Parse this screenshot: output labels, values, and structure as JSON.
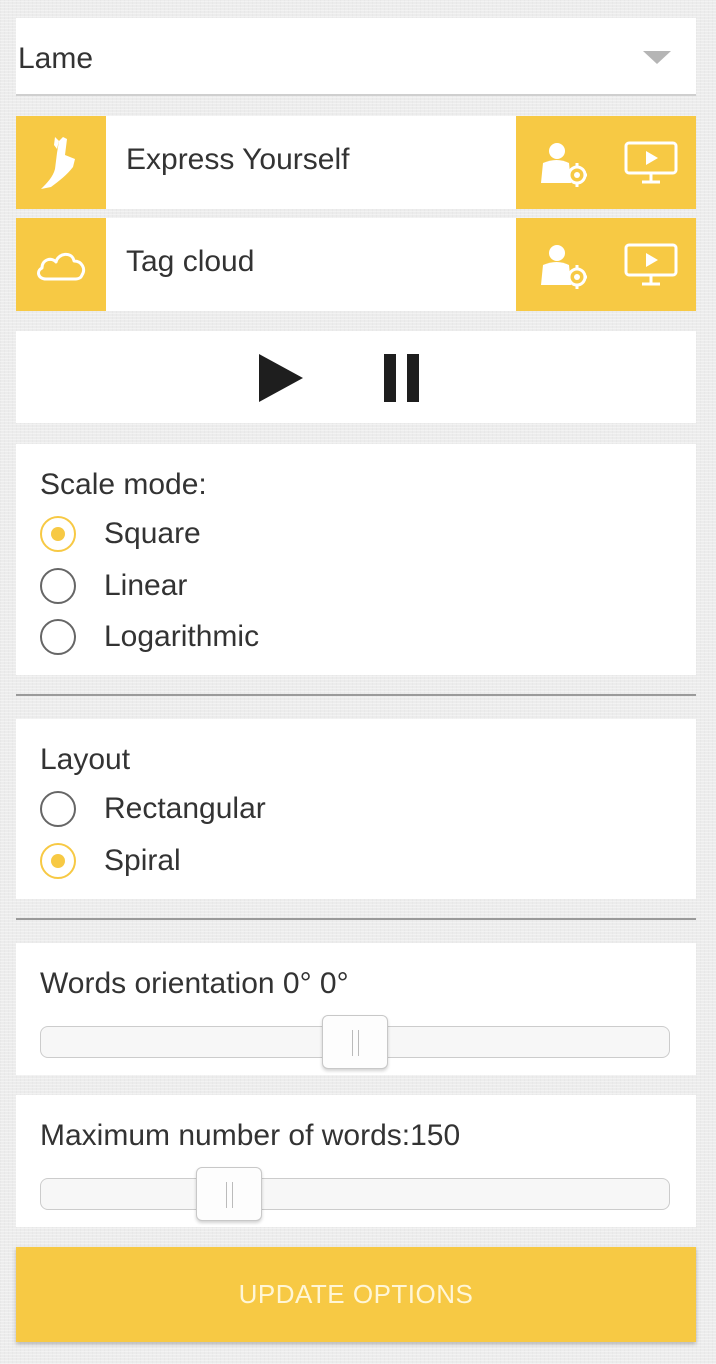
{
  "selector": {
    "value": "Lame"
  },
  "apps": [
    {
      "label": "Express Yourself",
      "icon": "hand-gesture-icon",
      "settings_icon": "user-settings-icon",
      "present_icon": "presentation-screen-icon"
    },
    {
      "label": "Tag cloud",
      "icon": "cloud-icon",
      "settings_icon": "user-settings-icon",
      "present_icon": "presentation-screen-icon"
    }
  ],
  "player": {
    "play_icon": "play-icon",
    "pause_icon": "pause-icon"
  },
  "scale_mode": {
    "title": "Scale mode:",
    "options": [
      "Square",
      "Linear",
      "Logarithmic"
    ],
    "selected": "Square"
  },
  "layout": {
    "title": "Layout",
    "options": [
      "Rectangular",
      "Spiral"
    ],
    "selected": "Spiral"
  },
  "orientation": {
    "label": "Words orientation 0° 0°",
    "value_fraction": 0.5
  },
  "max_words": {
    "label": "Maximum number of words:150",
    "value_fraction": 0.3
  },
  "update_button": {
    "label": "UPDATE OPTIONS"
  },
  "colors": {
    "accent": "#f7c944",
    "background": "#ececec",
    "card": "#ffffff"
  }
}
